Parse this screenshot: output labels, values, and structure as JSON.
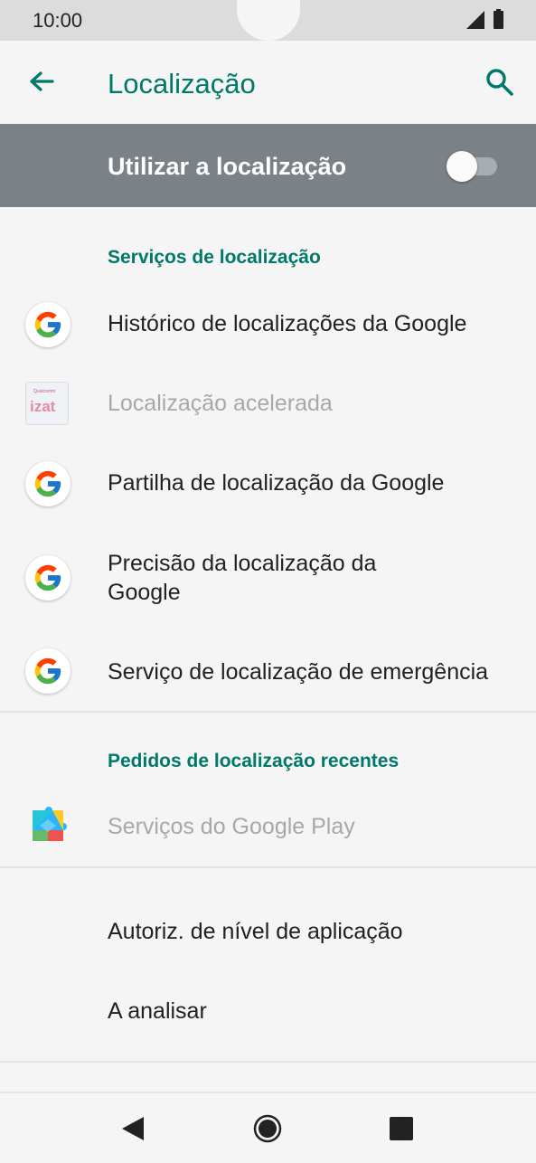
{
  "status_bar": {
    "time": "10:00"
  },
  "app_bar": {
    "title": "Localização",
    "back_icon": "arrow-left-icon",
    "search_icon": "search-icon"
  },
  "master_switch": {
    "label": "Utilizar a localização",
    "state": "off"
  },
  "sections": {
    "services_header": "Serviços de localização",
    "services": [
      {
        "label": "Histórico de localizações da Google",
        "icon": "google-g-icon",
        "enabled": true
      },
      {
        "label": "Localização acelerada",
        "icon": "qualcomm-izat-icon",
        "enabled": false,
        "icon_brand_text": "Qualcomm izat"
      },
      {
        "label": "Partilha de localização da Google",
        "icon": "google-g-icon",
        "enabled": true
      },
      {
        "label": "Precisão da localização da Google",
        "icon": "google-g-icon",
        "enabled": true
      },
      {
        "label": "Serviço de localização de emergência",
        "icon": "google-g-icon",
        "enabled": true
      }
    ],
    "recent_header": "Pedidos de localização recentes",
    "recent": [
      {
        "label": "Serviços do Google Play",
        "icon": "google-play-services-icon",
        "enabled": false
      }
    ],
    "other": [
      {
        "label": "Autoriz. de nível de aplicação"
      },
      {
        "label": "A analisar"
      }
    ]
  },
  "nav_bar": {
    "back_icon": "nav-back-icon",
    "home_icon": "nav-home-icon",
    "recents_icon": "nav-recents-icon"
  },
  "colors": {
    "accent": "#00796b",
    "switch_bar": "#7a8288",
    "background": "#f5f5f5"
  }
}
